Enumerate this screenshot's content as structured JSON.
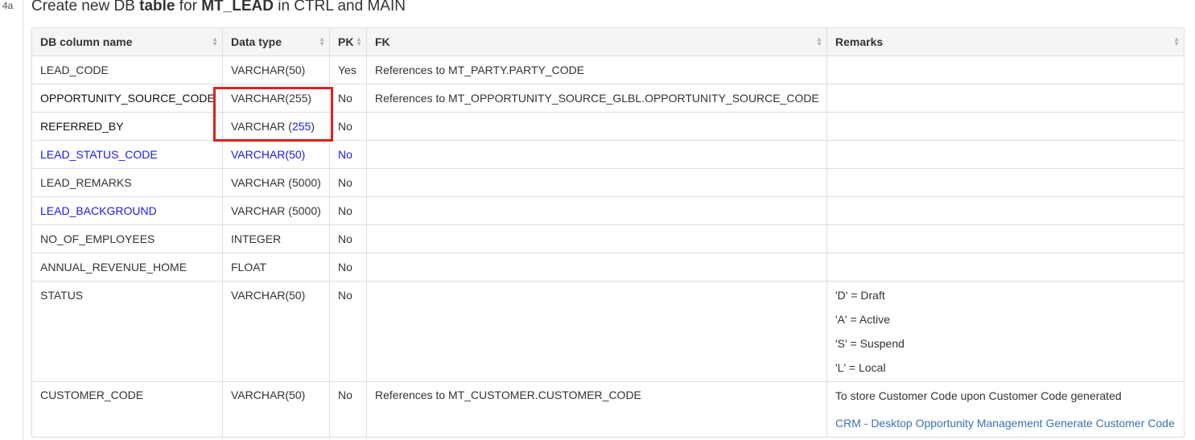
{
  "step_number": "4a",
  "heading": {
    "prefix": "Create new DB ",
    "bold1": "table",
    "mid": " for ",
    "bold2": "MT_LEAD",
    "suffix": " in CTRL and MAIN"
  },
  "columns": [
    {
      "label": "DB column name"
    },
    {
      "label": "Data type"
    },
    {
      "label": "PK"
    },
    {
      "label": "FK"
    },
    {
      "label": "Remarks"
    }
  ],
  "rows": [
    {
      "name": "LEAD_CODE",
      "type": "VARCHAR(50)",
      "pk": "Yes",
      "fk": "References to MT_PARTY.PARTY_CODE",
      "remarks": []
    },
    {
      "name": "OPPORTUNITY_SOURCE_CODE",
      "type": "VARCHAR(255)",
      "pk": "No",
      "fk": "References to MT_OPPORTUNITY_SOURCE_GLBL.OPPORTUNITY_SOURCE_CODE",
      "remarks": []
    },
    {
      "name": "REFERRED_BY",
      "type_prefix": "VARCHAR (",
      "type_num": "255",
      "type_suffix": ")",
      "pk": "No",
      "fk": "",
      "remarks": []
    },
    {
      "name": "LEAD_STATUS_CODE",
      "type": "VARCHAR(50)",
      "pk": "No",
      "fk": "",
      "remarks": []
    },
    {
      "name": "LEAD_REMARKS",
      "type": "VARCHAR (5000)",
      "pk": "No",
      "fk": "",
      "remarks": []
    },
    {
      "name": "LEAD_BACKGROUND",
      "type": "VARCHAR (5000)",
      "pk": "No",
      "fk": "",
      "remarks": []
    },
    {
      "name": "NO_OF_EMPLOYEES",
      "type": "INTEGER",
      "pk": "No",
      "fk": "",
      "remarks": []
    },
    {
      "name": "ANNUAL_REVENUE_HOME",
      "type": "FLOAT",
      "pk": "No",
      "fk": "",
      "remarks": []
    },
    {
      "name": "STATUS",
      "type": "VARCHAR(50)",
      "pk": "No",
      "fk": "",
      "remarks": [
        "'D' = Draft",
        "'A' = Active",
        "'S' = Suspend",
        "'L' = Local"
      ]
    },
    {
      "name": "CUSTOMER_CODE",
      "type": "VARCHAR(50)",
      "pk": "No",
      "fk": "References to MT_CUSTOMER.CUSTOMER_CODE",
      "remarks_text": "To store Customer Code upon Customer Code generated",
      "remarks_link": "CRM - Desktop Opportunity Management Generate Customer Code"
    }
  ],
  "colors": {
    "changed_text": "#1a1ae6",
    "link": "#3b73af",
    "highlight_box": "#e02020",
    "header_bg": "#f4f5f7",
    "border": "#dddddd"
  }
}
